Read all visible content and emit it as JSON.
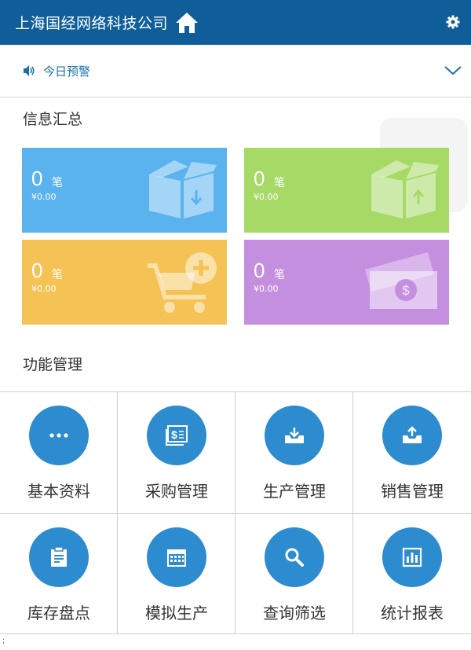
{
  "header": {
    "title": "上海国经网络科技公司",
    "home_icon": "home-icon",
    "settings_icon": "gear-icon"
  },
  "alert": {
    "label": "今日预警",
    "icon": "speaker-icon",
    "expand_icon": "chevron-down-icon"
  },
  "summary": {
    "title": "信息汇总",
    "cards": [
      {
        "count": "0",
        "unit": "笔",
        "amount": "¥0.00",
        "color": "#5ab3ee",
        "icon": "box-in-icon"
      },
      {
        "count": "0",
        "unit": "笔",
        "amount": "¥0.00",
        "color": "#a7d967",
        "icon": "box-out-icon"
      },
      {
        "count": "0",
        "unit": "笔",
        "amount": "¥0.00",
        "color": "#f5c255",
        "icon": "cart-add-icon"
      },
      {
        "count": "0",
        "unit": "笔",
        "amount": "¥0.00",
        "color": "#c58fe0",
        "icon": "money-icon"
      }
    ]
  },
  "functions": {
    "title": "功能管理",
    "items": [
      {
        "label": "基本资料",
        "icon": "more-icon"
      },
      {
        "label": "采购管理",
        "icon": "purchase-icon"
      },
      {
        "label": "生产管理",
        "icon": "inbox-download-icon"
      },
      {
        "label": "销售管理",
        "icon": "inbox-upload-icon"
      },
      {
        "label": "库存盘点",
        "icon": "clipboard-icon"
      },
      {
        "label": "模拟生产",
        "icon": "calendar-icon"
      },
      {
        "label": "查询筛选",
        "icon": "search-icon"
      },
      {
        "label": "统计报表",
        "icon": "bar-chart-icon"
      }
    ]
  },
  "footer": {
    "text": ";"
  },
  "colors": {
    "header": "#0f5e9a",
    "accent": "#2d8ccf",
    "alert_text": "#1d6fae"
  }
}
